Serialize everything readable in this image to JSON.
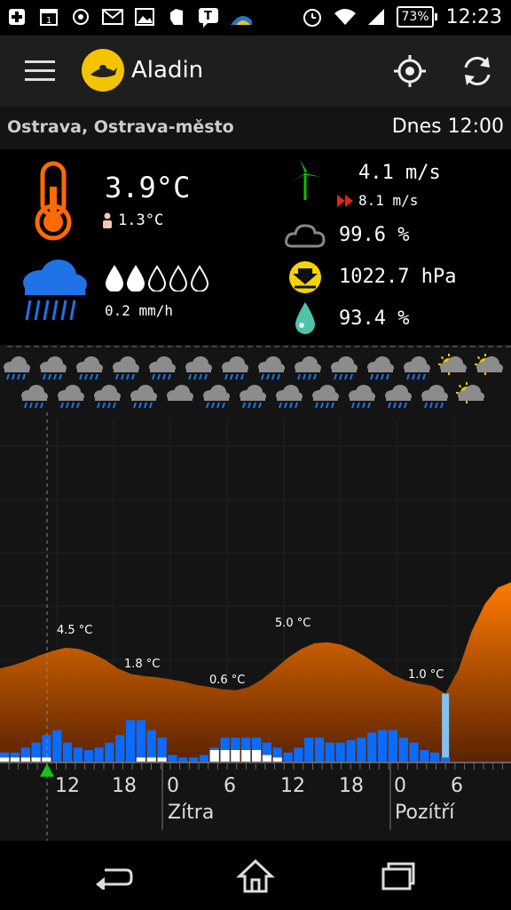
{
  "status_bar": {
    "battery": "73%",
    "time": "12:23",
    "icons": [
      "add-icon",
      "calendar-icon",
      "settings-app-icon",
      "gmail-icon",
      "gallery-icon",
      "evernote-icon",
      "talk-icon",
      "weather-widget-icon",
      "alarm-icon",
      "wifi-icon",
      "signal-icon",
      "battery-icon"
    ]
  },
  "app": {
    "title": "Aladin"
  },
  "location": {
    "name": "Ostrava, Ostrava-město",
    "when": "Dnes 12:00"
  },
  "current": {
    "temperature": "3.9°C",
    "feels_like": "1.3°C",
    "precip_amount": "0.2 mm/h",
    "precip_level": 2,
    "precip_max": 5,
    "wind": "4.1 m/s",
    "gust": "8.1 m/s",
    "cloud": "99.6 %",
    "pressure": "1022.7 hPa",
    "humidity": "93.4 %"
  },
  "forecast_icons": {
    "row1": [
      "rain",
      "rain",
      "rain",
      "rain",
      "rain",
      "rain",
      "rain",
      "rain",
      "rain",
      "rain",
      "rain",
      "rain",
      "sun-cloud",
      "sun-cloud"
    ],
    "row2": [
      "rain",
      "rain",
      "rain",
      "rain",
      "cloud",
      "rain",
      "rain",
      "rain",
      "rain",
      "rain",
      "rain",
      "rain",
      "sun-cloud"
    ]
  },
  "chart_data": {
    "type": "area",
    "x_ticks": [
      "12",
      "18",
      "0",
      "6",
      "12",
      "18",
      "0",
      "6"
    ],
    "day_labels": [
      "Zítra",
      "Pozítří"
    ],
    "temp_annotations": [
      "4.5 °C",
      "1.8 °C",
      "0.6 °C",
      "5.0 °C",
      "1.0 °C"
    ],
    "series": [
      {
        "name": "",
        "color": "#ff7a00",
        "values": [
          2.6,
          2.9,
          3.3,
          3.8,
          4.2,
          4.5,
          4.4,
          4.0,
          3.4,
          2.6,
          2.1,
          1.9,
          1.8,
          1.6,
          1.4,
          1.1,
          0.9,
          0.7,
          0.6,
          0.9,
          1.6,
          2.6,
          3.6,
          4.4,
          4.9,
          5.0,
          4.8,
          4.3,
          3.6,
          2.8,
          2.0,
          1.5,
          1.2,
          1.0,
          0.3,
          2.5,
          6.0,
          8.5,
          10.0,
          10.5
        ]
      },
      {
        "name": "",
        "color": "#0a6cff",
        "values": [
          0.4,
          0.4,
          0.6,
          0.8,
          1.1,
          1.3,
          0.8,
          0.6,
          0.5,
          0.6,
          0.8,
          1.1,
          1.7,
          1.7,
          1.3,
          1.0,
          0.3,
          0.2,
          0.2,
          0.3,
          0.6,
          1.0,
          1.0,
          1.0,
          1.0,
          0.8,
          0.6,
          0.4,
          0.6,
          1.0,
          1.0,
          0.8,
          0.8,
          0.9,
          1.0,
          1.2,
          1.3,
          1.3,
          1.0,
          0.8,
          0.5,
          0.4,
          0.2
        ]
      },
      {
        "name": "",
        "color": "#ffffff",
        "values": [
          0.2,
          0.2,
          0.2,
          0.2,
          0.2,
          0.0,
          0.0,
          0.0,
          0.0,
          0.0,
          0.0,
          0.0,
          0.0,
          0.2,
          0.2,
          0.2,
          0.0,
          0.0,
          0.0,
          0.0,
          0.5,
          0.5,
          0.5,
          0.5,
          0.5,
          0.3,
          0.2,
          0.0,
          0.0,
          0.0,
          0.0,
          0.0,
          0.0,
          0.0,
          0.0,
          0.0,
          0.0,
          0.0,
          0.0,
          0.0,
          0.0,
          0.0,
          0.0
        ]
      }
    ]
  },
  "nav": {
    "icons": [
      "back-icon",
      "home-icon",
      "recent-apps-icon"
    ]
  }
}
